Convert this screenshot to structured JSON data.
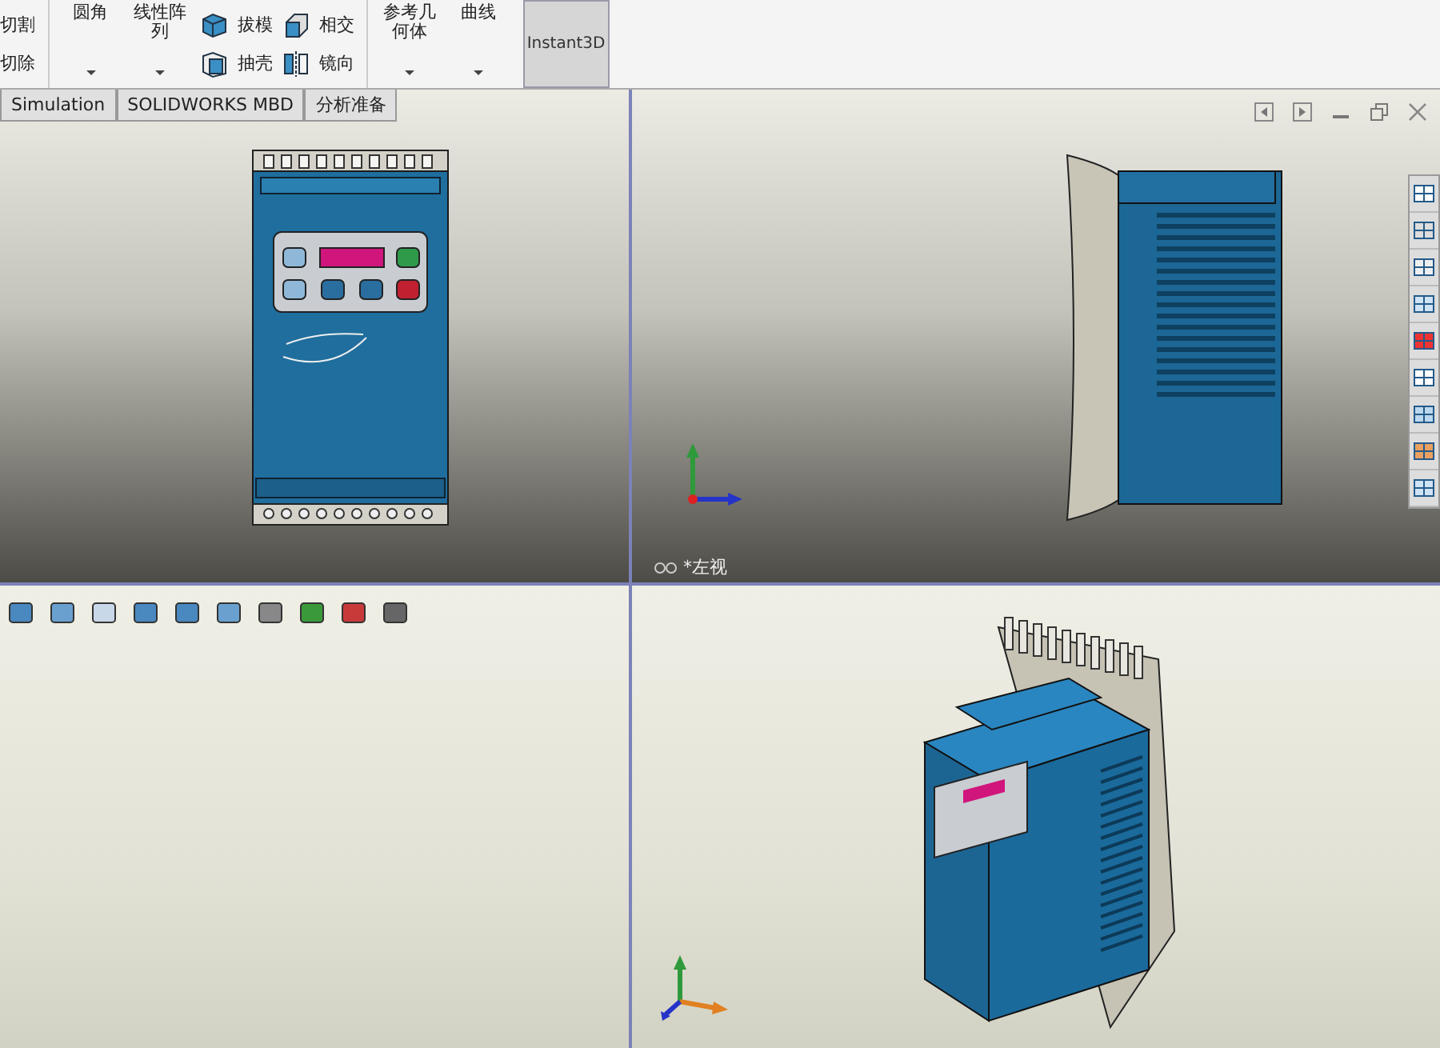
{
  "ribbon": {
    "clipped_commands": [
      "切割",
      "切除"
    ],
    "feature_buttons": [
      {
        "label": "圆角"
      },
      {
        "label": "线性阵列"
      }
    ],
    "small_commands": [
      {
        "label": "拔模",
        "kind": "draft"
      },
      {
        "label": "抽壳",
        "kind": "shell"
      },
      {
        "label": "相交",
        "kind": "intersect"
      },
      {
        "label": "镜向",
        "kind": "mirror"
      }
    ],
    "reference_buttons": [
      {
        "label": "参考几何体"
      },
      {
        "label": "曲线"
      }
    ],
    "instant3d": {
      "label": "Instant3D",
      "selected": true
    }
  },
  "tabs": [
    {
      "label": "Simulation",
      "selected": false
    },
    {
      "label": "SOLIDWORKS MBD",
      "selected": false
    },
    {
      "label": "分析准备",
      "selected": false
    }
  ],
  "viewports": {
    "side_view_label": "*左视"
  }
}
